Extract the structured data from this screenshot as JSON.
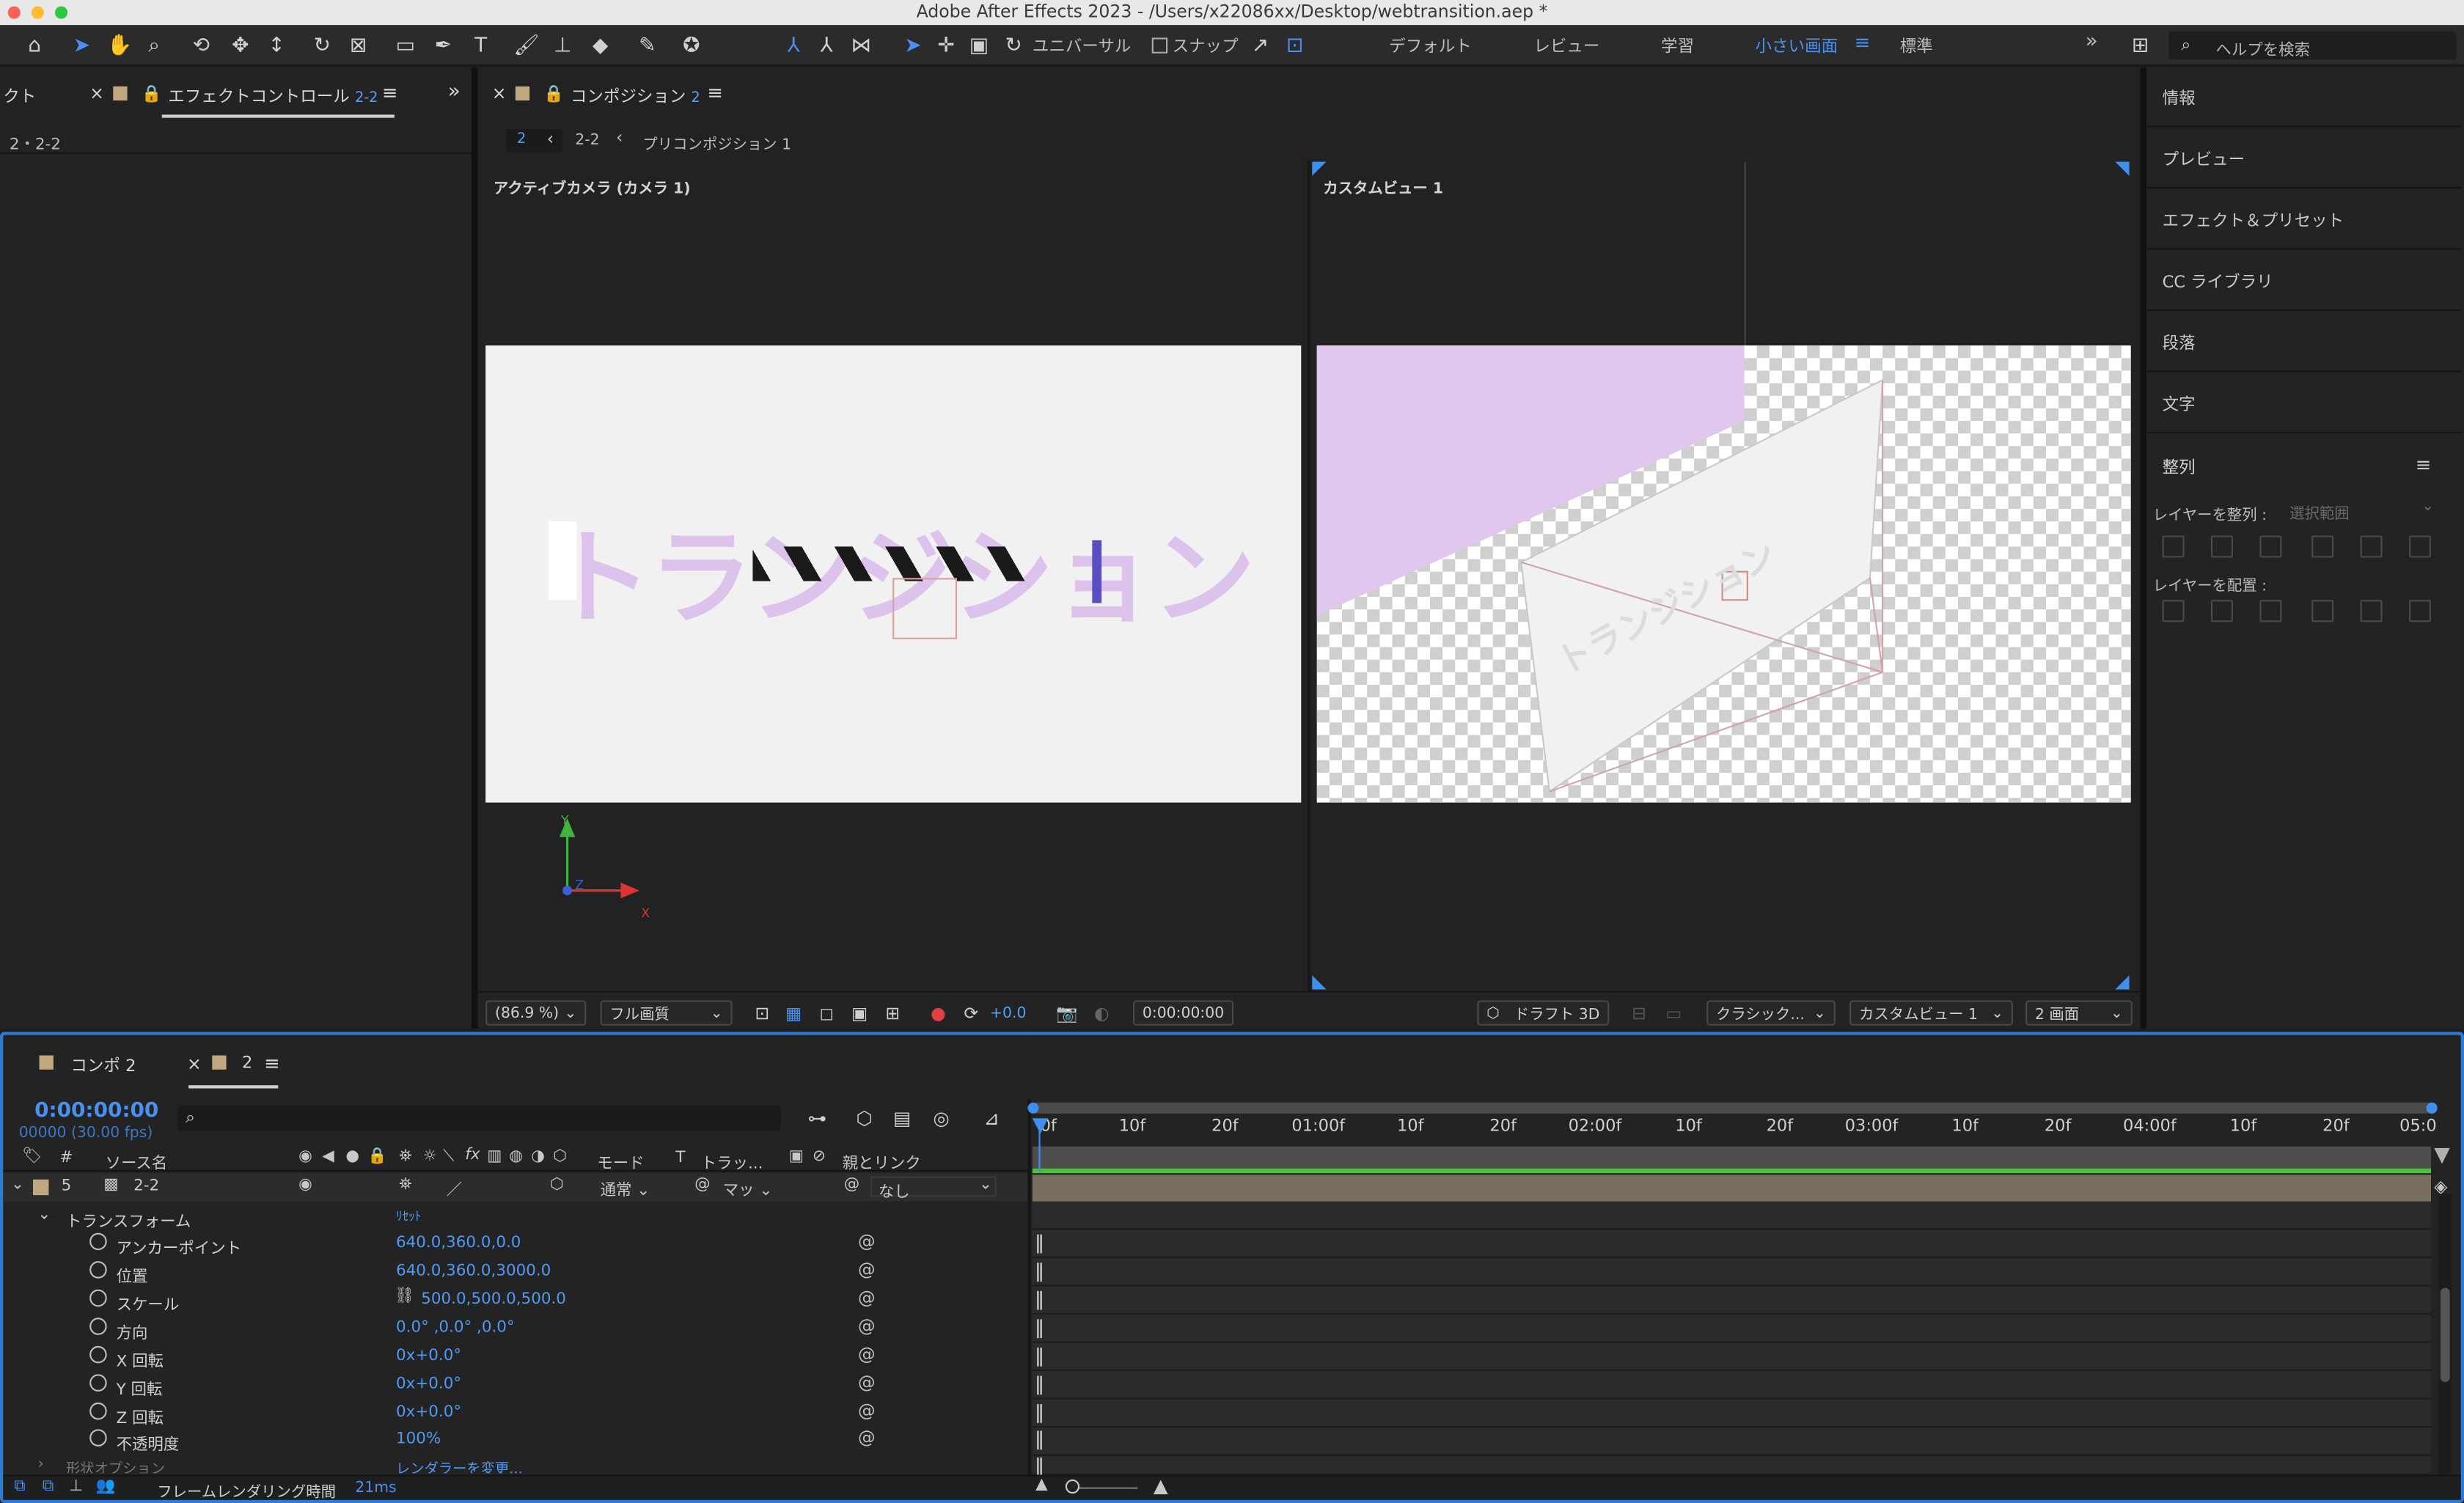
{
  "window": {
    "title": "Adobe After Effects 2023 - /Users/x22086xx/Desktop/webtransition.aep *"
  },
  "toolbar": {
    "universal": "ユニバーサル",
    "snap": "スナップ",
    "workspaces": [
      "デフォルト",
      "レビュー",
      "学習",
      "小さい画面",
      "標準"
    ],
    "active_workspace": "小さい画面",
    "search_placeholder": "ヘルプを検索"
  },
  "left_panel": {
    "partial_tab": "クト",
    "tab_label": "エフェクトコントロール",
    "tab_suffix": "2-2",
    "breadcrumb": "2・2-2"
  },
  "comp_panel": {
    "tab_label": "コンポジション",
    "tab_suffix": "2",
    "crumb_current": "2",
    "crumb_2": "2-2",
    "crumb_3": "プリコンポジション 1",
    "left_view_label": "アクティブカメラ (カメラ 1)",
    "right_view_label": "カスタムビュー 1",
    "comp_text": "トランジション",
    "axis_y": "Y",
    "axis_z": "Z",
    "axis_x": "X",
    "zoom": "(86.9 %)",
    "quality": "フル画質",
    "exposure": "+0.0",
    "timecode": "0:00:00:00",
    "draft3d": "ドラフト 3D",
    "renderer": "クラシック...",
    "view": "カスタムビュー 1",
    "layout": "2 画面"
  },
  "right_panels": [
    "情報",
    "プレビュー",
    "エフェクト＆プリセット",
    "CC ライブラリ",
    "段落",
    "文字"
  ],
  "align_panel": {
    "title": "整列",
    "align_label": "レイヤーを整列 :",
    "align_target": "選択範囲",
    "distribute_label": "レイヤーを配置 :"
  },
  "timeline": {
    "tabs": [
      {
        "label": "コンポ 2"
      },
      {
        "label": "2"
      }
    ],
    "timecode": "0:00:00:00",
    "fps": "00000 (30.00 fps)",
    "columns": {
      "num": "#",
      "source": "ソース名",
      "mode": "モード",
      "t": "T",
      "track": "トラッ...",
      "parent": "親とリンク"
    },
    "layer": {
      "index": "5",
      "name": "2-2",
      "mode": "通常",
      "matte": "マッ",
      "parent": "なし"
    },
    "transform": {
      "label": "トランスフォーム",
      "reset": "ﾘｾｯﾄ"
    },
    "props": [
      {
        "label": "アンカーポイント",
        "value": "640.0,360.0,0.0"
      },
      {
        "label": "位置",
        "value": "640.0,360.0,3000.0"
      },
      {
        "label": "スケール",
        "value": "500.0,500.0,500.0"
      },
      {
        "label": "方向",
        "value": "0.0° ,0.0° ,0.0°"
      },
      {
        "label": "X 回転",
        "value": "0x+0.0°"
      },
      {
        "label": "Y 回転",
        "value": "0x+0.0°"
      },
      {
        "label": "Z 回転",
        "value": "0x+0.0°"
      },
      {
        "label": "不透明度",
        "value": "100%"
      }
    ],
    "geometry": {
      "label": "形状オプション",
      "value": "レンダラーを変更..."
    },
    "ruler": [
      "0f",
      "10f",
      "20f",
      "01:00f",
      "10f",
      "20f",
      "02:00f",
      "10f",
      "20f",
      "03:00f",
      "10f",
      "20f",
      "04:00f",
      "10f",
      "20f",
      "05:0"
    ],
    "status": {
      "label": "フレームレンダリング時間",
      "value": "21ms"
    }
  },
  "colors": {
    "accent": "#4a90f0",
    "comp_bg": "#f1f1f1",
    "text_pink": "#dcc3ec",
    "layer_bar": "#7a6e5f",
    "timeline_green": "#48c23c"
  }
}
